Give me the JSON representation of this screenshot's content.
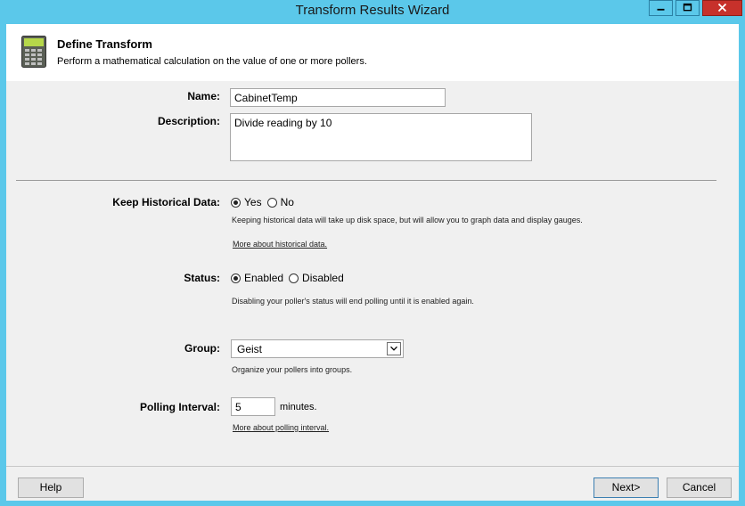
{
  "window": {
    "title": "Transform Results Wizard"
  },
  "header": {
    "title": "Define Transform",
    "subtitle": "Perform a mathematical calculation on the value of one or more pollers."
  },
  "form": {
    "name": {
      "label": "Name:",
      "value": "CabinetTemp"
    },
    "description": {
      "label": "Description:",
      "value": "Divide reading by 10"
    },
    "keep_historical": {
      "label": "Keep Historical Data:",
      "options": [
        "Yes",
        "No"
      ],
      "selected": "Yes",
      "hint": "Keeping historical data will take up disk space, but will allow you to graph data and display gauges.",
      "link": "More about historical data."
    },
    "status": {
      "label": "Status:",
      "options": [
        "Enabled",
        "Disabled"
      ],
      "selected": "Enabled",
      "hint": "Disabling your poller's status will end polling until it is enabled again."
    },
    "group": {
      "label": "Group:",
      "value": "Geist",
      "hint": "Organize your pollers into groups."
    },
    "polling_interval": {
      "label": "Polling Interval:",
      "value": "5",
      "unit": "minutes.",
      "link": "More about polling interval."
    }
  },
  "footer": {
    "help": "Help",
    "next": "Next>",
    "cancel": "Cancel"
  }
}
